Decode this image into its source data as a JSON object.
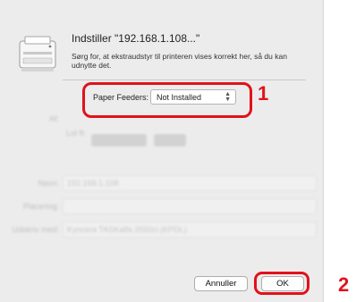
{
  "dialog": {
    "title": "Indstiller \"192.168.1.108...\"",
    "description": "Sørg for, at ekstraudstyr til printeren vises korrekt her, så du kan udnytte det.",
    "paper_feeders_label": "Paper Feeders:",
    "paper_feeders_value": "Not Installed",
    "cancel_label": "Annuller",
    "ok_label": "OK"
  },
  "background_form": {
    "name_label": "Navn:",
    "name_value": "192.168.1.108",
    "location_label": "Placering:",
    "driver_label": "Udskriv med:",
    "driver_value": "Kyocera TASKalfa 2550ci (KPDL)",
    "kind_label": "Af:",
    "via_label": "Lol ft:"
  },
  "callouts": {
    "step1": "1",
    "step2": "2"
  },
  "colors": {
    "highlight": "#e0121b",
    "sheet_bg": "#ececec"
  }
}
